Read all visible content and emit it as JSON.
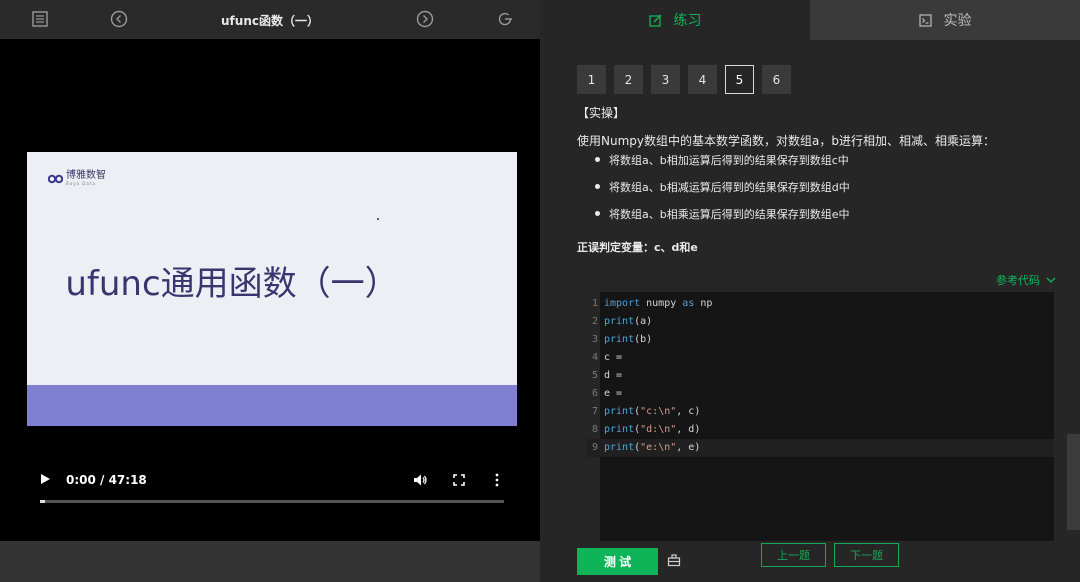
{
  "video": {
    "title": "ufunc函数（一）",
    "slide_title": "ufunc通用函数（一）",
    "brand": "博雅数智",
    "brand_sub": "Boya Data",
    "time": "0:00 / 47:18",
    "progress": 0.0
  },
  "tabs": {
    "practice": "练习",
    "experiment": "实验"
  },
  "questions": [
    "1",
    "2",
    "3",
    "4",
    "5",
    "6"
  ],
  "active_question": "5",
  "task": {
    "section": "【实操】",
    "description": "使用Numpy数组中的基本数学函数，对数组a，b进行相加、相减、相乘运算：",
    "bullets": [
      "将数组a、b相加运算后得到的结果保存到数组c中",
      "将数组a、b相减运算后得到的结果保存到数组d中",
      "将数组a、b相乘运算后得到的结果保存到数组e中"
    ],
    "judge": "正误判定变量：c、d和e"
  },
  "reference_code_label": "参考代码",
  "code": {
    "line_numbers": [
      "1",
      "2",
      "3",
      "4",
      "5",
      "6",
      "7",
      "8",
      "9"
    ],
    "lines": [
      [
        "import",
        " numpy ",
        "as",
        " np"
      ],
      [
        "print",
        "(a)"
      ],
      [
        "print",
        "(b)"
      ],
      [
        "c ="
      ],
      [
        "d ="
      ],
      [
        "e ="
      ],
      [
        "print",
        "(",
        "\"c:\\n\"",
        ", c)"
      ],
      [
        "print",
        "(",
        "\"d:\\n\"",
        ", d)"
      ],
      [
        "print",
        "(",
        "\"e:\\n\"",
        ", e)"
      ]
    ]
  },
  "buttons": {
    "test": "测 试",
    "prev": "上一题",
    "next": "下一题"
  },
  "colors": {
    "accent": "#0fb358",
    "slide_band": "#7f80d2",
    "slide_title": "#3a356e"
  }
}
